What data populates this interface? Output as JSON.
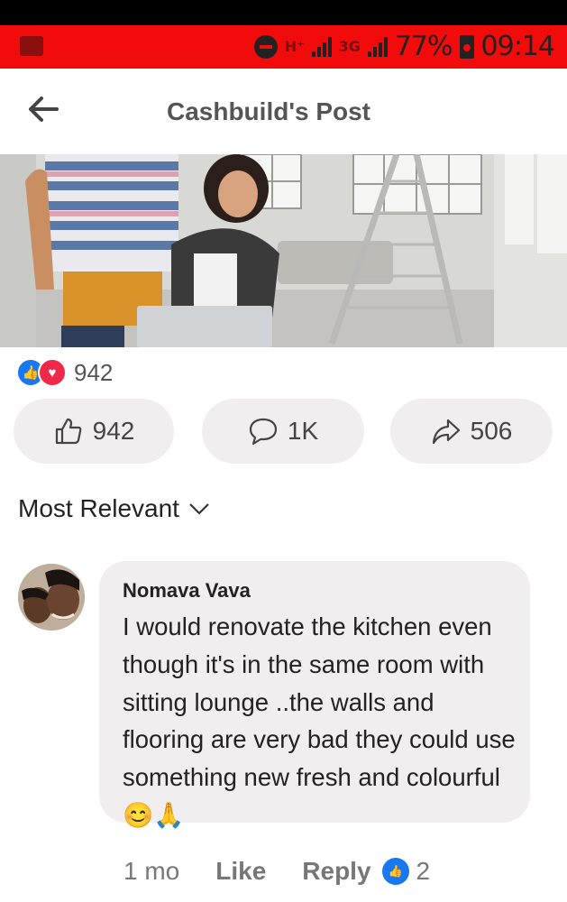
{
  "status_bar": {
    "network_1": "H⁺",
    "network_2": "3G",
    "battery": "77%",
    "time": "09:14"
  },
  "header": {
    "back_icon": "arrow-left-icon",
    "title": "Cashbuild's Post"
  },
  "reactions": {
    "count": "942"
  },
  "actions": {
    "like_count": "942",
    "comment_count": "1K",
    "share_count": "506"
  },
  "sort": {
    "label": "Most Relevant"
  },
  "comment": {
    "author": "Nomava Vava",
    "text": "I would renovate the kitchen even though it's in the same room with sitting lounge ..the walls and flooring are very bad they could use something new fresh and colourful😊🙏",
    "age": "1 mo",
    "like_label": "Like",
    "reply_label": "Reply",
    "reaction_count": "2"
  },
  "colors": {
    "status_bar": "#f10b0b",
    "like_blue": "#1877f2",
    "love_red": "#f02849",
    "pill_bg": "#f1eeef"
  }
}
